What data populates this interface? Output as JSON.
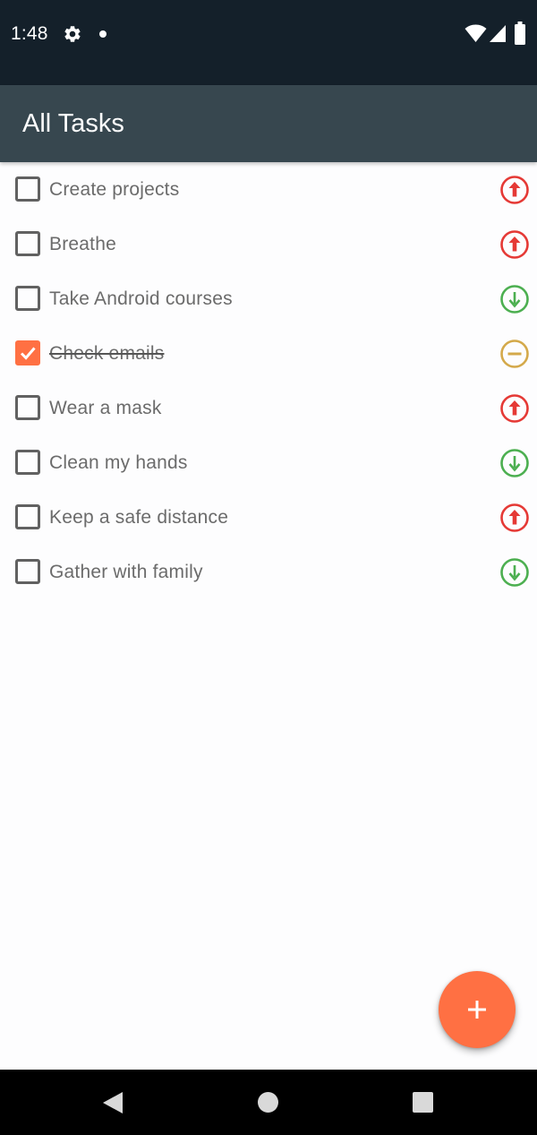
{
  "status_bar": {
    "time": "1:48",
    "icons": [
      "gear-icon",
      "notification-dot-icon",
      "wifi-icon",
      "cell-signal-icon",
      "battery-icon"
    ]
  },
  "app_bar": {
    "title": "All Tasks",
    "background": "#37474f"
  },
  "tasks": [
    {
      "label": "Create projects",
      "checked": false,
      "priority": "high"
    },
    {
      "label": "Breathe",
      "checked": false,
      "priority": "high"
    },
    {
      "label": "Take Android courses",
      "checked": false,
      "priority": "low"
    },
    {
      "label": "Check emails",
      "checked": true,
      "priority": "medium"
    },
    {
      "label": "Wear a mask",
      "checked": false,
      "priority": "high"
    },
    {
      "label": "Clean my hands",
      "checked": false,
      "priority": "low"
    },
    {
      "label": "Keep a safe distance",
      "checked": false,
      "priority": "high"
    },
    {
      "label": "Gather with family",
      "checked": false,
      "priority": "low"
    }
  ],
  "priority_colors": {
    "high": "#e53935",
    "medium": "#d4a94a",
    "low": "#4caf50"
  },
  "fab": {
    "icon": "plus-icon",
    "color": "#ff7043"
  },
  "nav_bar": {
    "icons": [
      "back-icon",
      "home-icon",
      "recents-icon"
    ]
  }
}
